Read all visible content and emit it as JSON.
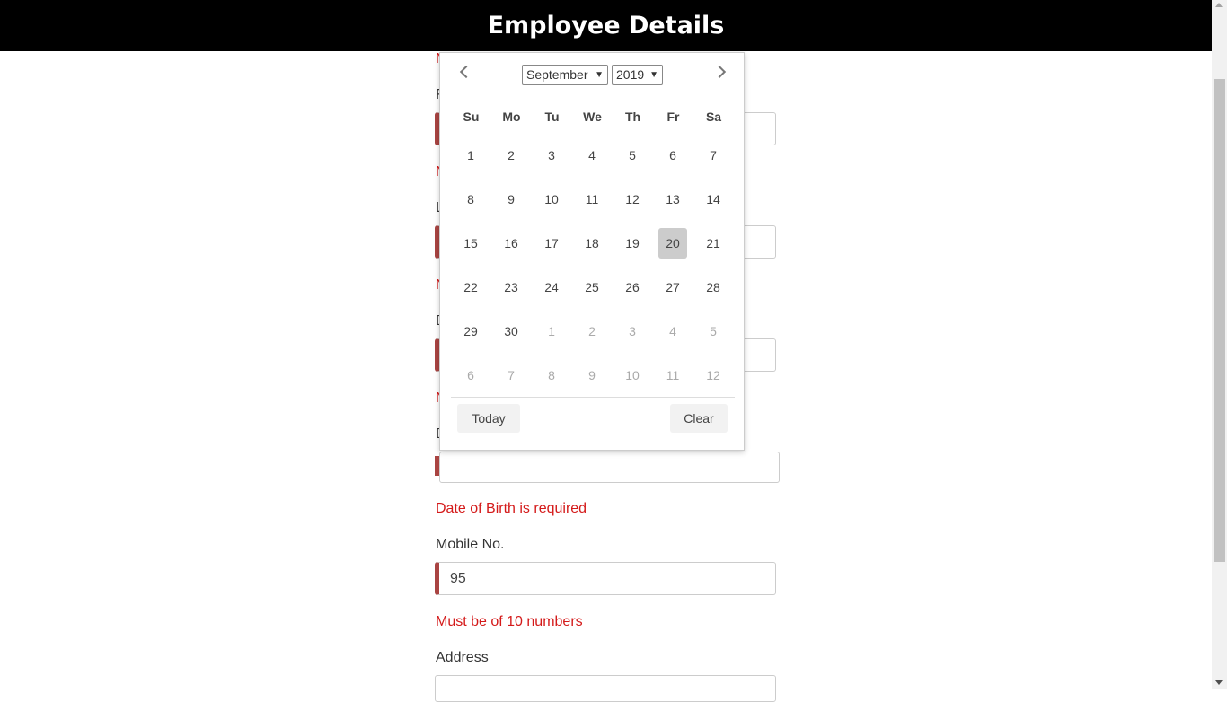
{
  "header": {
    "title": "Employee Details"
  },
  "form": {
    "clipped": {
      "n1": "N",
      "f": "F",
      "n2": "N",
      "l": "L",
      "n3": "N",
      "d1": "D",
      "n4": "N",
      "d2": "D"
    },
    "dob_error": "Date of Birth is required",
    "mobile": {
      "label": "Mobile No.",
      "value": "95",
      "error": "Must be of 10 numbers"
    },
    "address": {
      "label": "Address"
    }
  },
  "datepicker": {
    "month": "September",
    "year": "2019",
    "weekdays": [
      "Su",
      "Mo",
      "Tu",
      "We",
      "Th",
      "Fr",
      "Sa"
    ],
    "weeks": [
      [
        "1",
        "2",
        "3",
        "4",
        "5",
        "6",
        "7"
      ],
      [
        "8",
        "9",
        "10",
        "11",
        "12",
        "13",
        "14"
      ],
      [
        "15",
        "16",
        "17",
        "18",
        "19",
        "20",
        "21"
      ],
      [
        "22",
        "23",
        "24",
        "25",
        "26",
        "27",
        "28"
      ],
      [
        "29",
        "30",
        "1",
        "2",
        "3",
        "4",
        "5"
      ],
      [
        "6",
        "7",
        "8",
        "9",
        "10",
        "11",
        "12"
      ]
    ],
    "selected": "20",
    "today_label": "Today",
    "clear_label": "Clear"
  }
}
